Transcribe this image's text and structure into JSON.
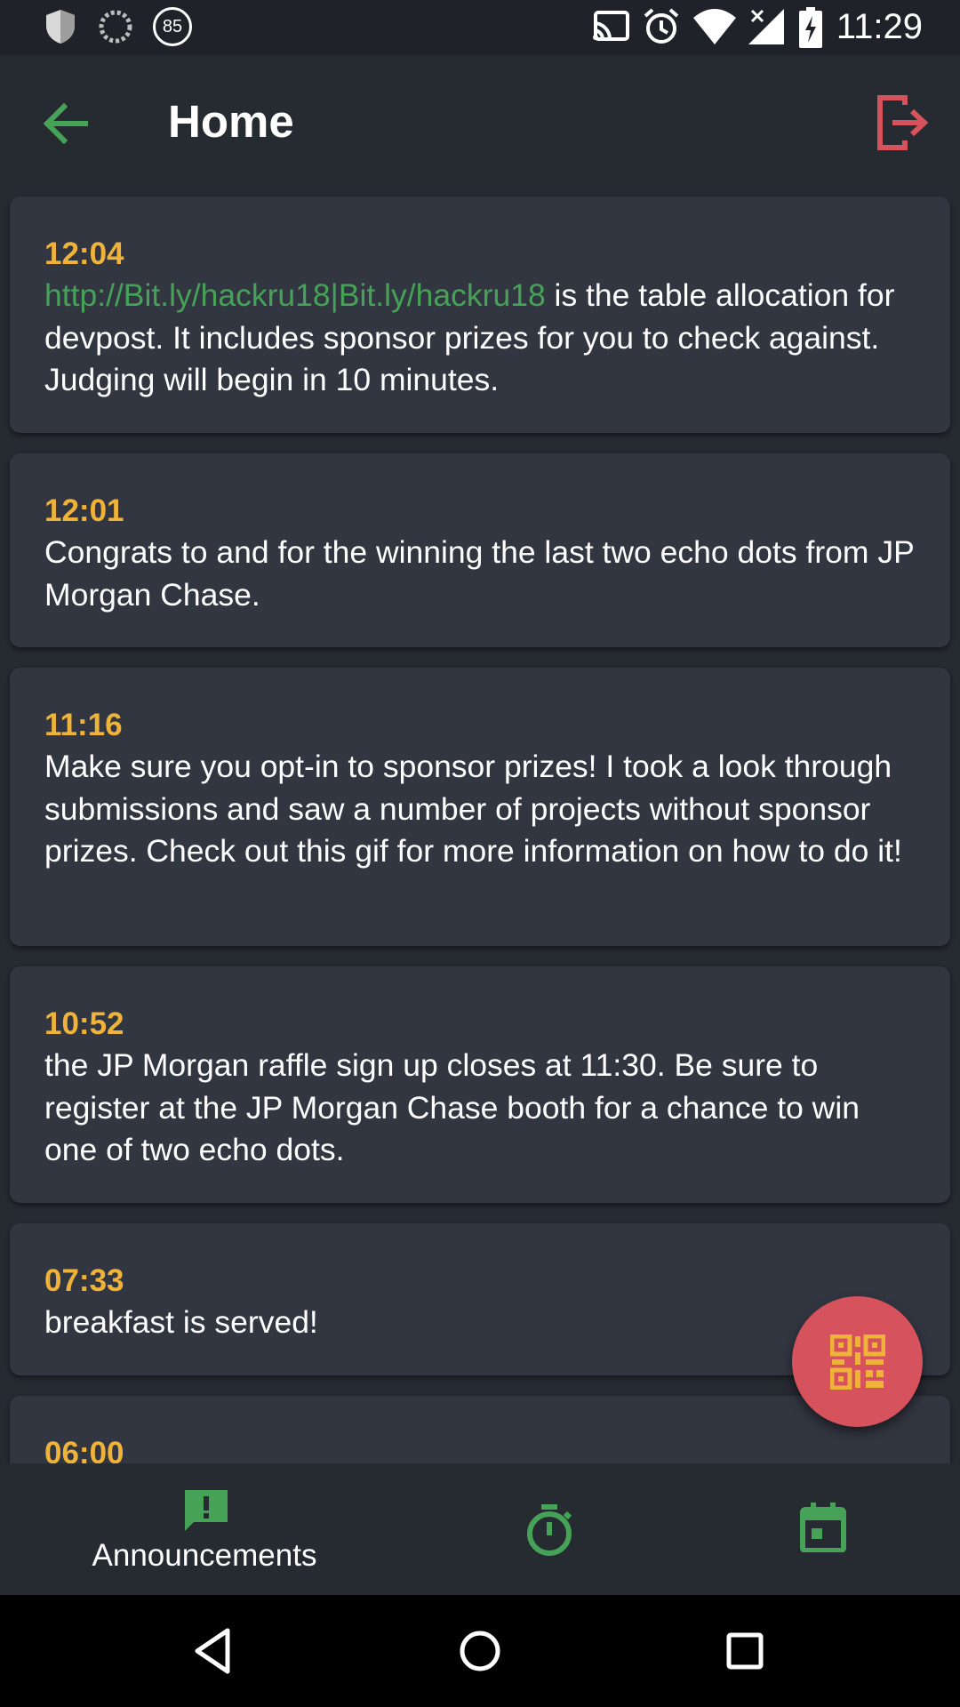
{
  "status_bar": {
    "time": "11:29",
    "notification_badge": "85",
    "icons": [
      "shield-icon",
      "sync-icon",
      "badge-85-icon",
      "cast-icon",
      "alarm-icon",
      "wifi-icon",
      "no-signal-icon",
      "battery-charging-icon"
    ]
  },
  "app_bar": {
    "title": "Home",
    "back_icon": "arrow-back-icon",
    "logout_icon": "logout-icon"
  },
  "announcements": [
    {
      "time": "12:04",
      "link": "http://Bit.ly/hackru18|Bit.ly/hackru18",
      "text": " is the table allocation for devpost. It includes sponsor prizes for you to check against. Judging will begin in 10 minutes."
    },
    {
      "time": "12:01",
      "text": "Congrats to and for the winning the last two echo dots from JP Morgan Chase."
    },
    {
      "time": "11:16",
      "text": "Make sure you opt-in to sponsor prizes! I took a look through submissions and saw a number of projects without sponsor prizes. Check out this gif for more information on how to do it!"
    },
    {
      "time": "10:52",
      "text": "the JP Morgan raffle sign up closes at 11:30. Be sure to register at the JP Morgan Chase booth for a chance to win one of two echo dots."
    },
    {
      "time": "07:33",
      "text": "breakfast is served!"
    },
    {
      "time": "06:00",
      "text": ""
    }
  ],
  "fab": {
    "icon": "qr-code-icon"
  },
  "bottom_nav": {
    "items": [
      {
        "label": "Announcements",
        "icon": "announcement-icon",
        "active": true
      },
      {
        "label": "",
        "icon": "timer-icon",
        "active": false
      },
      {
        "label": "",
        "icon": "calendar-icon",
        "active": false
      }
    ]
  },
  "colors": {
    "background": "#262a31",
    "card": "#323641",
    "time_accent": "#f0b33a",
    "green_accent": "#46a257",
    "logout_red": "#d6525c",
    "fab_red": "#d6525c"
  }
}
